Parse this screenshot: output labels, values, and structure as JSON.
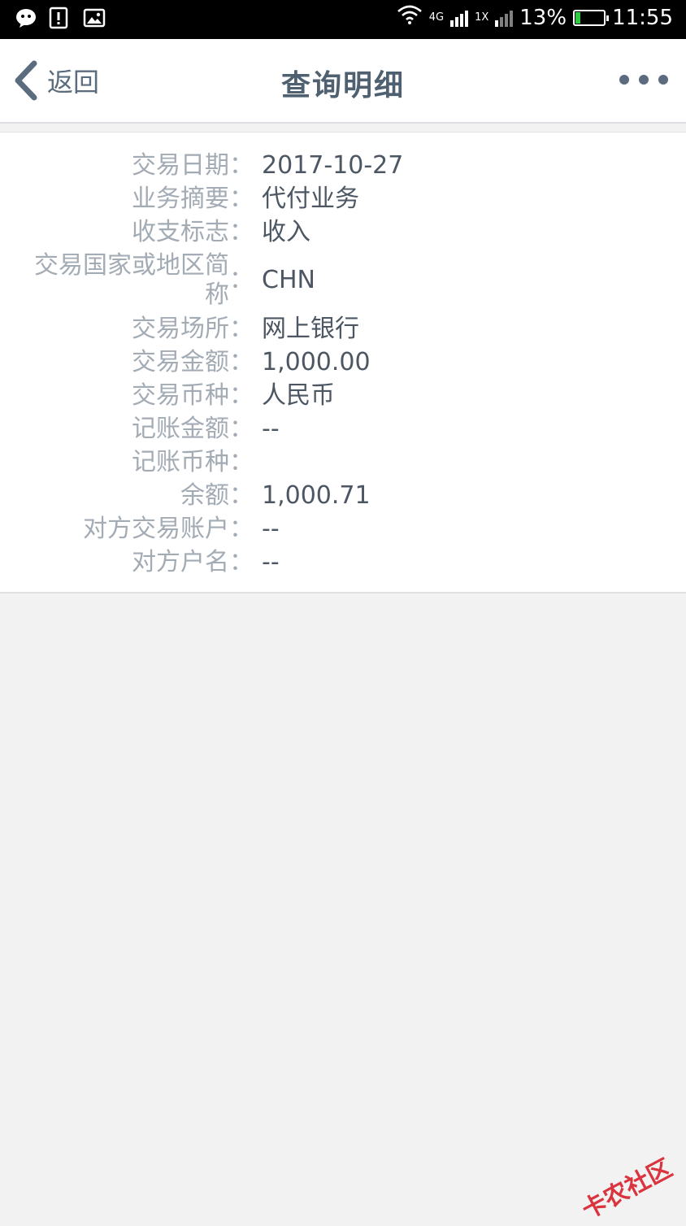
{
  "status_bar": {
    "network_4g": "4G",
    "network_1x": "1X",
    "battery_percent": "13%",
    "time": "11:55",
    "icons": [
      "wechat-icon",
      "alert-icon",
      "image-icon"
    ]
  },
  "header": {
    "back_label": "返回",
    "title": "查询明细"
  },
  "details": [
    {
      "label": "交易日期",
      "value": "2017-10-27"
    },
    {
      "label": "业务摘要",
      "value": "代付业务"
    },
    {
      "label": "收支标志",
      "value": "收入"
    },
    {
      "label": "交易国家或地区简称",
      "value": "CHN"
    },
    {
      "label": "交易场所",
      "value": "网上银行"
    },
    {
      "label": "交易金额",
      "value": "1,000.00"
    },
    {
      "label": "交易币种",
      "value": "人民币"
    },
    {
      "label": "记账金额",
      "value": "--"
    },
    {
      "label": "记账币种",
      "value": ""
    },
    {
      "label": "余额",
      "value": "1,000.71"
    },
    {
      "label": "对方交易账户",
      "value": "--"
    },
    {
      "label": "对方户名",
      "value": "--"
    }
  ],
  "colon": "：",
  "watermark": "卡农社区",
  "colors": {
    "header_text": "#4f6070",
    "label_text": "#a3abb4",
    "value_text": "#4c5763",
    "background": "#f2f2f2",
    "battery_fill": "#2ecc40",
    "watermark": "#d8242f"
  }
}
